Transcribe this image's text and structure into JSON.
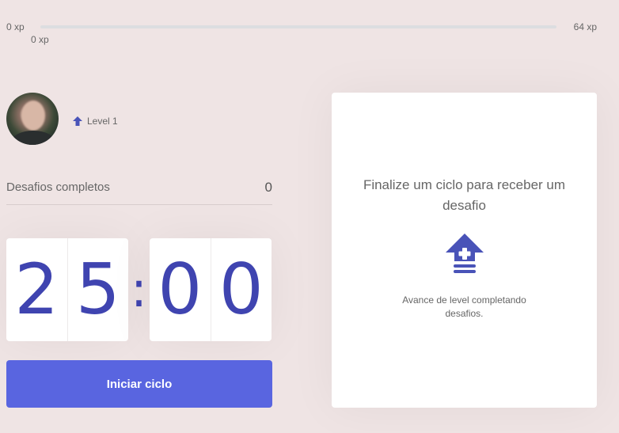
{
  "experience_bar": {
    "min_label": "0 xp",
    "current_label": "0 xp",
    "max_label": "64 xp",
    "progress_fraction": 0
  },
  "profile": {
    "level_label": "Level 1",
    "level_icon": "level-up-arrow-icon"
  },
  "completed_challenges": {
    "label": "Desafios completos",
    "value": "0"
  },
  "countdown": {
    "minute_left": "2",
    "minute_right": "5",
    "separator": ":",
    "second_left": "0",
    "second_right": "0"
  },
  "start_button": {
    "label": "Iniciar ciclo"
  },
  "challenge_box": {
    "title": "Finalize um ciclo para receber um desafio",
    "icon": "level-up-icon",
    "hint": "Avance de level completando desafios."
  },
  "colors": {
    "background": "#efe4e4",
    "accent": "#5965e0",
    "digit": "#3f44b0",
    "level_icon": "#4953b8"
  }
}
